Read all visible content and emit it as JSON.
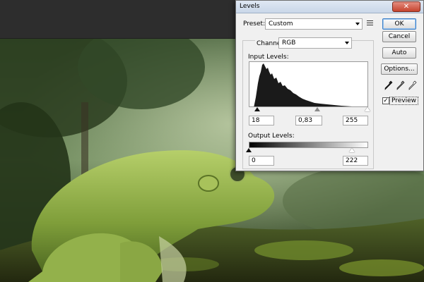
{
  "dialog": {
    "title": "Levels",
    "close_glyph": "✕",
    "preset": {
      "label": "Preset:",
      "value": "Custom"
    },
    "channel": {
      "label": "Channel:",
      "value": "RGB"
    },
    "input_levels": {
      "label": "Input Levels:",
      "black": "18",
      "gamma": "0,83",
      "white": "255",
      "black_fraction": 0.07,
      "gamma_fraction": 0.58,
      "white_fraction": 1.0
    },
    "output_levels": {
      "label": "Output Levels:",
      "black": "0",
      "white": "222",
      "black_fraction": 0.0,
      "white_fraction": 0.87
    },
    "buttons": {
      "ok": "OK",
      "cancel": "Cancel",
      "auto": "Auto",
      "options": "Options..."
    },
    "preview": {
      "label": "Preview",
      "checked": true,
      "check_glyph": "✓"
    },
    "eyedroppers": [
      "black-eyedropper-icon",
      "gray-eyedropper-icon",
      "white-eyedropper-icon"
    ]
  },
  "colors": {
    "dialog_bg": "#f0f0f0",
    "close_button": "#c6442e",
    "default_button_border": "#3b7fc7"
  }
}
